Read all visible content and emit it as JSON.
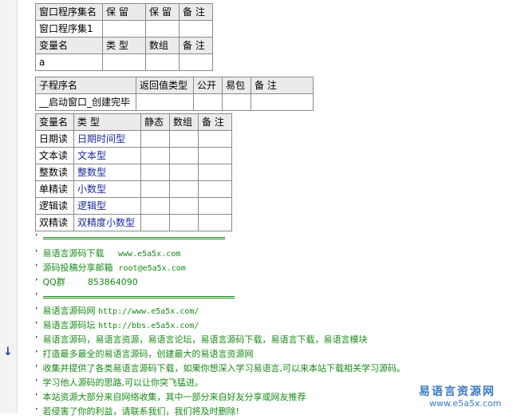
{
  "program_set_table": {
    "headers": [
      "窗口程序集名",
      "保 留",
      "保 留",
      "备 注"
    ],
    "row": [
      "窗口程序集1",
      "",
      "",
      ""
    ],
    "var_headers": [
      "变量名",
      "类 型",
      "数组",
      "备 注"
    ],
    "var_row": [
      "a",
      "",
      "",
      ""
    ]
  },
  "subroutine_table": {
    "headers": [
      "子程序名",
      "返回值类型",
      "公开",
      "易包",
      "备 注"
    ],
    "row": [
      "__启动窗口_创建完毕",
      "",
      "",
      "",
      ""
    ]
  },
  "local_var_table": {
    "headers": [
      "变量名",
      "类 型",
      "静态",
      "数组",
      "备 注"
    ],
    "rows": [
      [
        "日期读",
        "日期时间型"
      ],
      [
        "文本读",
        "文本型"
      ],
      [
        "整数读",
        "整数型"
      ],
      [
        "单精读",
        "小数型"
      ],
      [
        "逻辑读",
        "逻辑型"
      ],
      [
        "双精读",
        "双精度小数型"
      ]
    ]
  },
  "comments": {
    "quote": "’",
    "download_label": "易语言源码下载",
    "download_url": "www.e5a5x.com",
    "email_label": "源码投稿分享邮箱",
    "email": "root@e5a5x.com",
    "qq_label": "QQ群",
    "qq_number": "853864090",
    "site_label": "易语言源码网",
    "site_url": "http://www.e5a5x.com/",
    "forum_label": "易语言源码坛",
    "forum_url": "http://bbs.e5a5x.com/",
    "line_keywords": "易语言源码，易语言资源，易语言论坛，易语言源码下载，易语言下载，易语言模块",
    "line_build": "打造最多最全的易语言源码，创建最大的易语言资源网",
    "line_collect": "收集并提供了各类易语言源码下载，如果你想深入学习易语言,可以来本站下载相关学习源码。",
    "line_learn": "学习他人源码的思路,可以让你突飞猛进。",
    "line_source": "本站资源大部分来自网络收集，其中一部分来自好友分享或网友推荐",
    "line_contact": "若侵害了你的利益，请联系我们，我们将及时删除!"
  },
  "watermark": {
    "title": "易语言资源网",
    "url": "www.e5a5x.com"
  },
  "gutter": {
    "arrow_glyph": "↓"
  }
}
